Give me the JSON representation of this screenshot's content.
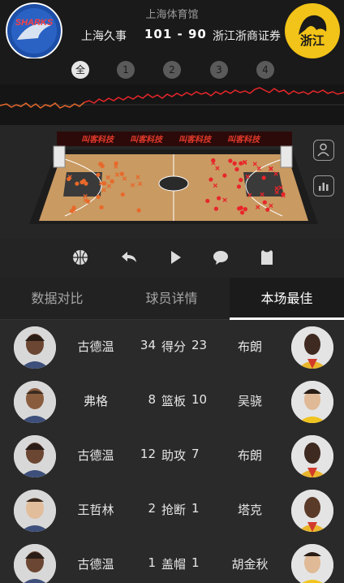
{
  "header": {
    "venue": "上海体育馆",
    "home_team": "上海久事",
    "away_team": "浙江浙商证券",
    "score": "101 - 90",
    "home_logo_text": "SHARKS",
    "away_logo_text": "浙江"
  },
  "periods": [
    "全",
    "1",
    "2",
    "3",
    "4"
  ],
  "court": {
    "ad_banner": "叫客科技",
    "home_color": "#e8682a",
    "away_color": "#e8262a"
  },
  "momentum": {
    "home_color": "#e8682a",
    "away_color": "#e8262a"
  },
  "toolbar": {
    "icons": [
      "basketball-icon",
      "replay-icon",
      "play-icon",
      "comment-icon",
      "jersey-icon"
    ]
  },
  "tabs": [
    "数据对比",
    "球员详情",
    "本场最佳"
  ],
  "best": [
    {
      "left_player": "古德温",
      "left_value": "34",
      "stat": "得分",
      "right_value": "23",
      "right_player": "布朗"
    },
    {
      "left_player": "弗格",
      "left_value": "8",
      "stat": "篮板",
      "right_value": "10",
      "right_player": "吴骁"
    },
    {
      "left_player": "古德温",
      "left_value": "12",
      "stat": "助攻",
      "right_value": "7",
      "right_player": "布朗"
    },
    {
      "left_player": "王哲林",
      "left_value": "2",
      "stat": "抢断",
      "right_value": "1",
      "right_player": "塔克"
    },
    {
      "left_player": "古德温",
      "left_value": "1",
      "stat": "盖帽",
      "right_value": "1",
      "right_player": "胡金秋"
    }
  ]
}
